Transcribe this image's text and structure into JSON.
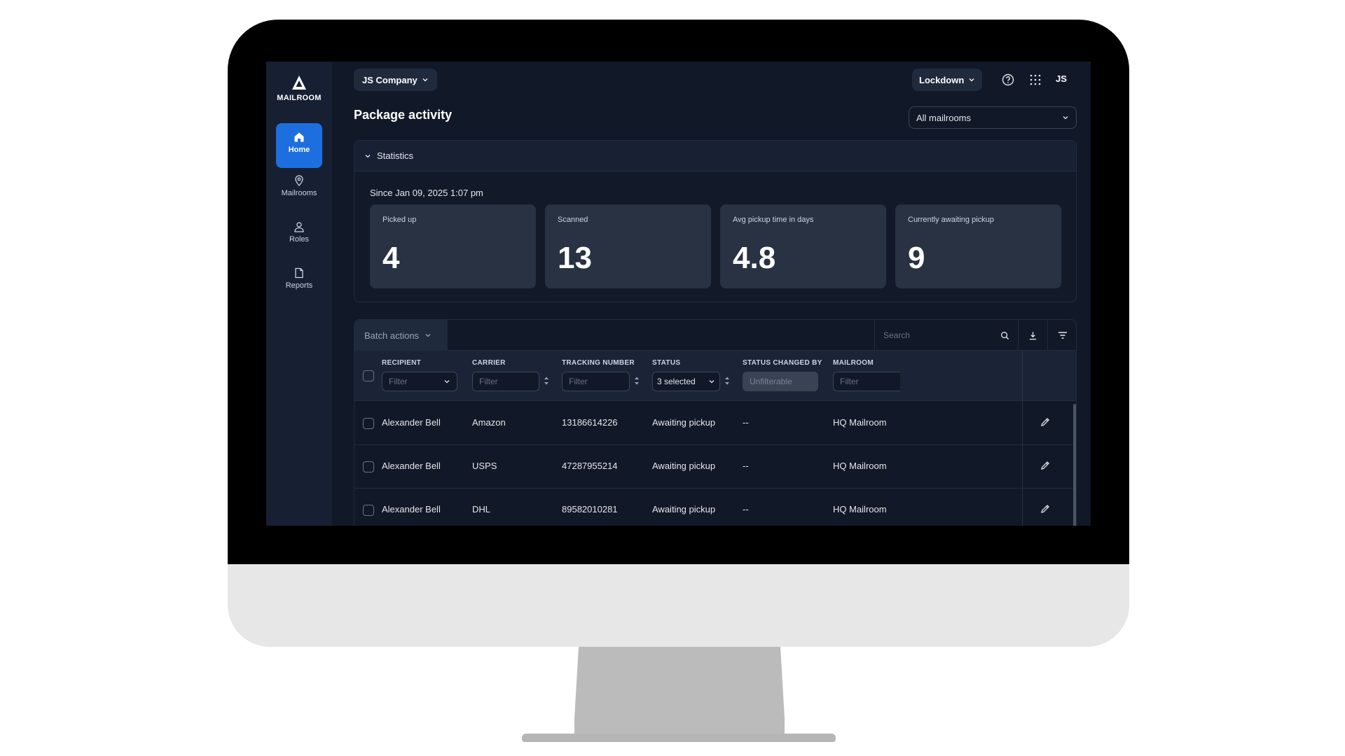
{
  "brand": {
    "name": "MAILROOM"
  },
  "sidebar": {
    "items": [
      {
        "label": "Home",
        "icon": "home-icon",
        "active": true
      },
      {
        "label": "Mailrooms",
        "icon": "map-pin-icon",
        "active": false
      },
      {
        "label": "Roles",
        "icon": "user-icon",
        "active": false
      },
      {
        "label": "Reports",
        "icon": "file-icon",
        "active": false
      }
    ]
  },
  "header": {
    "company": "JS Company",
    "lockdown": "Lockdown",
    "user_initials": "JS"
  },
  "page": {
    "title": "Package activity",
    "mailroom_select": "All mailrooms"
  },
  "statistics": {
    "title": "Statistics",
    "since": "Since Jan 09, 2025 1:07 pm",
    "cards": [
      {
        "label": "Picked up",
        "value": "4"
      },
      {
        "label": "Scanned",
        "value": "13"
      },
      {
        "label": "Avg pickup time in days",
        "value": "4.8"
      },
      {
        "label": "Currently awaiting pickup",
        "value": "9"
      }
    ]
  },
  "table": {
    "batch_actions": "Batch actions",
    "search_placeholder": "Search",
    "columns": [
      {
        "label": "RECIPIENT",
        "filter": "Filter"
      },
      {
        "label": "CARRIER",
        "filter": "Filter"
      },
      {
        "label": "TRACKING NUMBER",
        "filter": "Filter"
      },
      {
        "label": "STATUS",
        "filter": "3 selected"
      },
      {
        "label": "STATUS CHANGED BY",
        "filter": "Unfilterable"
      },
      {
        "label": "MAILROOM",
        "filter": "Filter"
      }
    ],
    "rows": [
      {
        "recipient": "Alexander Bell",
        "carrier": "Amazon",
        "tracking": "13186614226",
        "status": "Awaiting pickup",
        "changed_by": "--",
        "mailroom": "HQ Mailroom"
      },
      {
        "recipient": "Alexander Bell",
        "carrier": "USPS",
        "tracking": "47287955214",
        "status": "Awaiting pickup",
        "changed_by": "--",
        "mailroom": "HQ Mailroom"
      },
      {
        "recipient": "Alexander Bell",
        "carrier": "DHL",
        "tracking": "89582010281",
        "status": "Awaiting pickup",
        "changed_by": "--",
        "mailroom": "HQ Mailroom"
      }
    ]
  },
  "colors": {
    "accent": "#1d6fe0",
    "background": "#111827",
    "sidebar": "#172033",
    "card": "#283243"
  }
}
